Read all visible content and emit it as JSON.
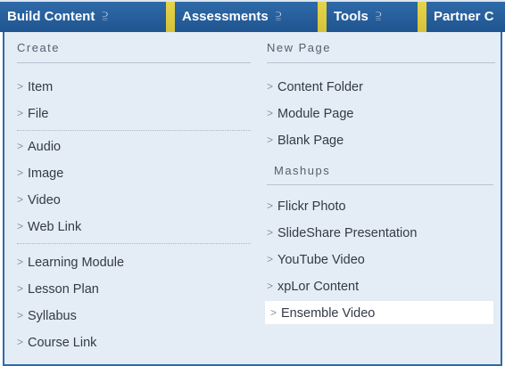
{
  "tabs": {
    "build": "Build Content",
    "assessments": "Assessments",
    "tools": "Tools",
    "partner": "Partner C"
  },
  "menu": {
    "create": {
      "heading": "Create",
      "group1": [
        "Item",
        "File"
      ],
      "group2": [
        "Audio",
        "Image",
        "Video",
        "Web Link"
      ],
      "group3": [
        "Learning Module",
        "Lesson Plan",
        "Syllabus",
        "Course Link"
      ]
    },
    "new_page": {
      "heading": "New Page",
      "items": [
        "Content Folder",
        "Module Page",
        "Blank Page"
      ]
    },
    "mashups": {
      "heading": "Mashups",
      "items": [
        "Flickr Photo",
        "SlideShare Presentation",
        "YouTube Video",
        "xpLor Content",
        "Ensemble Video"
      ]
    }
  },
  "colors": {
    "tab_blue": "#2f6aa8",
    "tab_separator": "#e6d44a",
    "panel_bg": "#e4ecf6",
    "highlight_bg": "#ffffff"
  }
}
